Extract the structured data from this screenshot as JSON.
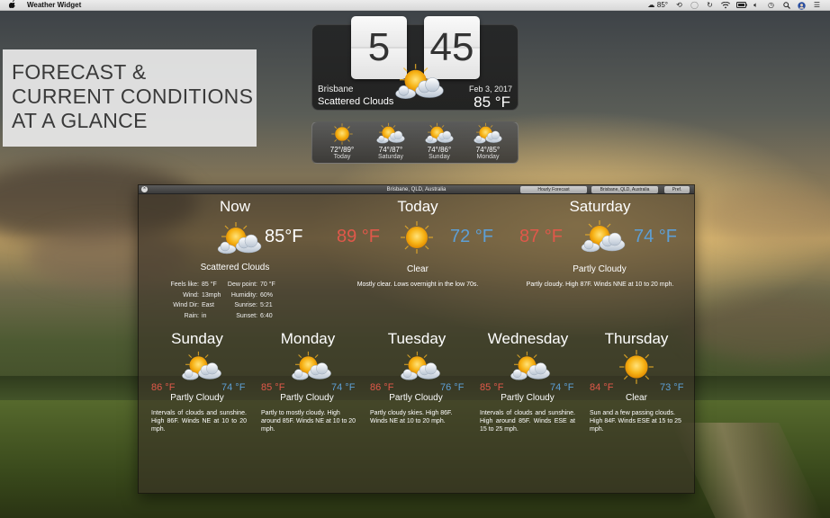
{
  "menubar": {
    "app_name": "Weather Widget",
    "weather_temp": "85°"
  },
  "promo": {
    "lines": [
      "FORECAST &",
      "CURRENT CONDITIONS",
      "AT A GLANCE"
    ]
  },
  "clock": {
    "hour": "5",
    "minute": "45",
    "city": "Brisbane",
    "condition": "Scattered Clouds",
    "date": "Feb 3, 2017",
    "temp": "85 °F"
  },
  "mini_forecast": [
    {
      "temps": "72°/89°",
      "day": "Today",
      "icon": "sun"
    },
    {
      "temps": "74°/87°",
      "day": "Saturday",
      "icon": "sun-cloud"
    },
    {
      "temps": "74°/86°",
      "day": "Sunday",
      "icon": "sun-cloud"
    },
    {
      "temps": "74°/85°",
      "day": "Monday",
      "icon": "sun-cloud"
    }
  ],
  "panel": {
    "title": "Brisbane, QLD, Australia",
    "buttons": {
      "hourly": "Hourly Forecast",
      "location": "Brisbane, QLD, Australia",
      "pref": "Pref."
    },
    "now": {
      "heading": "Now",
      "temp": "85°F",
      "condition": "Scattered Clouds",
      "details_left": [
        {
          "k": "Feels like:",
          "v": "85 °F"
        },
        {
          "k": "Wind:",
          "v": "13mph"
        },
        {
          "k": "Wind Dir:",
          "v": "East"
        },
        {
          "k": "Rain:",
          "v": "in"
        }
      ],
      "details_right": [
        {
          "k": "Dew point:",
          "v": "70 °F"
        },
        {
          "k": "Humidity:",
          "v": "60%"
        },
        {
          "k": "Sunrise:",
          "v": "5:21"
        },
        {
          "k": "Sunset:",
          "v": "6:40"
        }
      ]
    },
    "today": {
      "heading": "Today",
      "high": "89 °F",
      "low": "72 °F",
      "condition": "Clear",
      "desc": "Mostly clear. Lows overnight in the low 70s."
    },
    "saturday": {
      "heading": "Saturday",
      "high": "87 °F",
      "low": "74 °F",
      "condition": "Partly Cloudy",
      "desc": "Partly cloudy. High 87F. Winds NNE at 10 to 20 mph."
    },
    "days": [
      {
        "name": "Sunday",
        "high": "86 °F",
        "low": "74 °F",
        "condition": "Partly Cloudy",
        "desc": "Intervals of clouds and sunshine. High 86F. Winds NE at 10 to 20 mph.",
        "icon": "sun-cloud"
      },
      {
        "name": "Monday",
        "high": "85 °F",
        "low": "74 °F",
        "condition": "Partly Cloudy",
        "desc": "Partly to mostly cloudy. High around 85F. Winds NE at 10 to 20 mph.",
        "icon": "sun-cloud"
      },
      {
        "name": "Tuesday",
        "high": "86 °F",
        "low": "76 °F",
        "condition": "Partly Cloudy",
        "desc": "Partly cloudy skies. High 86F. Winds NE at 10 to 20 mph.",
        "icon": "sun-cloud"
      },
      {
        "name": "Wednesday",
        "high": "85 °F",
        "low": "74 °F",
        "condition": "Partly Cloudy",
        "desc": "Intervals of clouds and sunshine. High around 85F. Winds ESE at 15 to 25 mph.",
        "icon": "sun-cloud"
      },
      {
        "name": "Thursday",
        "high": "84 °F",
        "low": "73 °F",
        "condition": "Clear",
        "desc": "Sun and a few passing clouds. High 84F. Winds ESE at 15 to 25 mph.",
        "icon": "sun"
      }
    ]
  }
}
